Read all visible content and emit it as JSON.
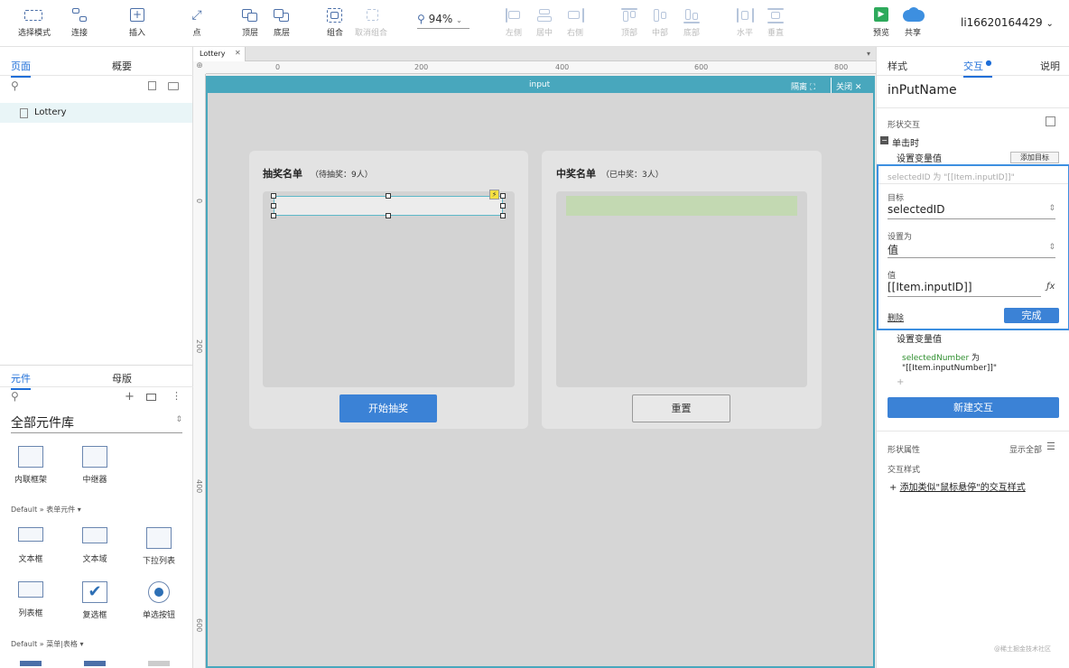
{
  "toolbar": {
    "select_mode": "选择模式",
    "connect": "连接",
    "insert": "插入",
    "point": "点",
    "top_layer": "顶层",
    "bottom_layer": "底层",
    "group": "组合",
    "ungroup": "取消组合",
    "zoom": "94%",
    "align_left": "左侧",
    "align_center": "居中",
    "align_right": "右侧",
    "align_top": "顶部",
    "align_middle": "中部",
    "align_bottom": "底部",
    "horizontal": "水平",
    "vertical": "垂直",
    "preview": "预览",
    "share": "共享",
    "user": "li16620164429"
  },
  "left": {
    "tabs": [
      "页面",
      "概要"
    ],
    "pages": [
      "Lottery"
    ],
    "lib_tabs": [
      "元件",
      "母版"
    ],
    "library_name": "全部元件库",
    "items_top": [
      "内联框架",
      "中继器"
    ],
    "section_form": "Default » 表单元件 ▾",
    "form_items": [
      "文本框",
      "文本域",
      "下拉列表",
      "列表框",
      "复选框",
      "单选按钮"
    ],
    "section_menu": "Default » 菜单|表格 ▾"
  },
  "canvas": {
    "doc_tab": "Lottery",
    "ruler_h": [
      "0",
      "200",
      "400",
      "600",
      "800"
    ],
    "ruler_v": [
      "0",
      "200",
      "400",
      "600"
    ],
    "frame_title": "input",
    "isolate": "隔离",
    "close": "关闭",
    "draw_list_title": "抽奖名单",
    "draw_list_count": "（待抽奖：9人）",
    "win_list_title": "中奖名单",
    "win_list_count": "（已中奖：3人）",
    "start_button": "开始抽奖",
    "reset_button": "重置"
  },
  "right": {
    "tabs": [
      "样式",
      "交互",
      "说明"
    ],
    "widget_name": "inPutName",
    "shape_interaction": "形状交互",
    "on_click": "单击时",
    "set_var": "设置变量值",
    "add_target": "添加目标",
    "summary": "selectedID 为 \"[[Item.inputID]]\"",
    "target_label": "目标",
    "target_value": "selectedID",
    "set_to_label": "设置为",
    "set_to_value": "值",
    "value_label": "值",
    "value_value": "[[Item.inputID]]",
    "delete": "删除",
    "done": "完成",
    "set_var2": "设置变量值",
    "var2_name": "selectedNumber",
    "var2_as": " 为",
    "var2_value": "\"[[Item.inputNumber]]\"",
    "plus": "+",
    "new_interaction": "新建交互",
    "shape_props": "形状属性",
    "show_all": "显示全部",
    "interaction_style": "交互样式",
    "add_style": "添加类似\"鼠标悬停\"的交互样式",
    "watermark": "@稀土掘金技术社区"
  }
}
